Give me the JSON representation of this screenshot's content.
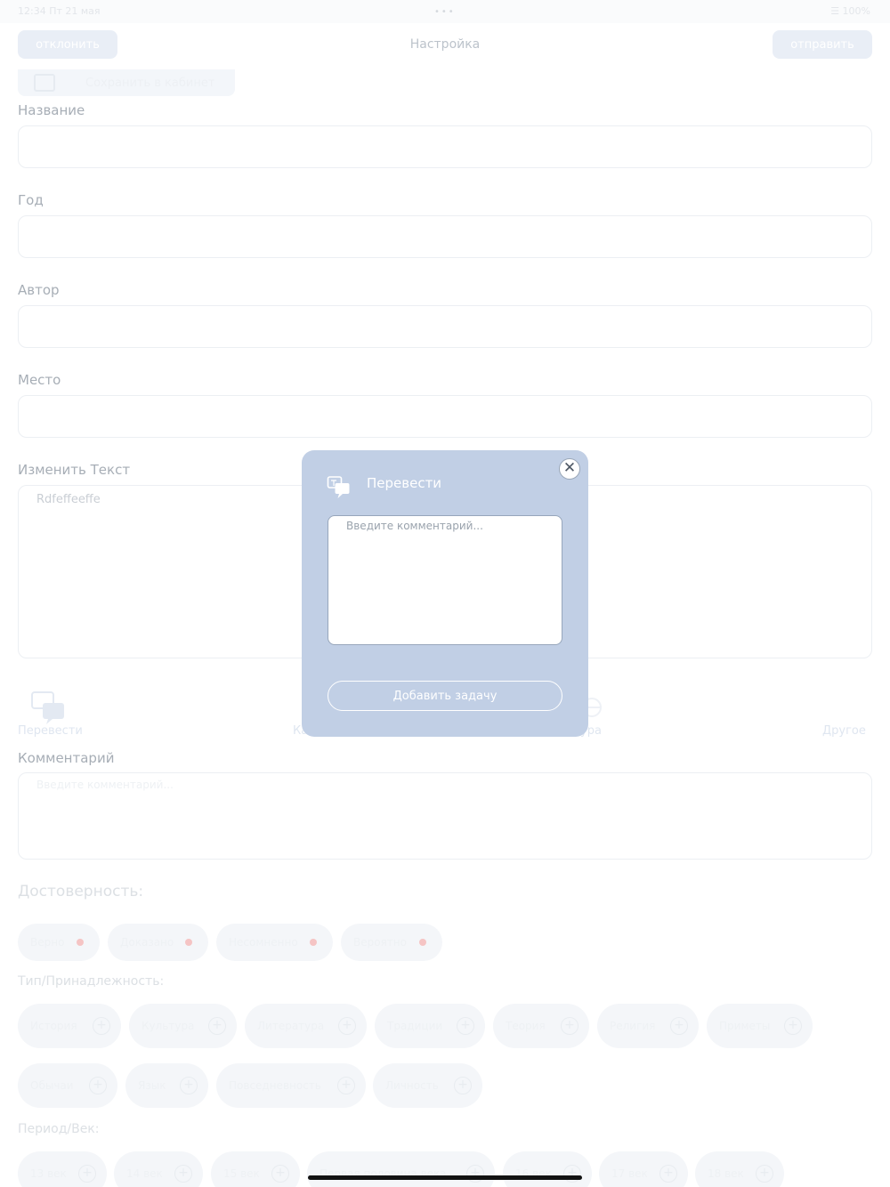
{
  "status_bar": {
    "left": "12:34  Пт 21 мая",
    "dots": "•••",
    "right": "☰  100%"
  },
  "header": {
    "decline_label": "отклонить",
    "title": "Настройка",
    "send_label": "отправить"
  },
  "save_button": {
    "label": "Сохранить в кабинет"
  },
  "fields": {
    "name_label": "Название",
    "name_value": "",
    "year_label": "Год",
    "year_value": "",
    "author_label": "Автор",
    "author_value": "",
    "place_label": "Место",
    "place_value": "",
    "text_label": "Изменить Текст",
    "text_value": "Rdfeffeeffe"
  },
  "categories": {
    "translate": "Перевести",
    "second": "Ка",
    "fourth": "ура",
    "other": "Другое"
  },
  "comment": {
    "label": "Комментарий",
    "placeholder": "Введите комментарий..."
  },
  "reliability": {
    "title": "Достоверность:",
    "chips": [
      "Верно",
      "Доказано",
      "Несомненно",
      "Вероятно"
    ]
  },
  "type": {
    "title": "Тип/Принадлежность:",
    "chips_row1": [
      "История",
      "Культура",
      "Литература",
      "Традиции",
      "Теория",
      "Религия",
      "Приметы"
    ],
    "chips_row2": [
      "Обычаи",
      "Язык",
      "Повседневность",
      "Личность"
    ]
  },
  "period": {
    "title": "Период/Век:",
    "chips": [
      "13 век",
      "14 век",
      "15 век",
      "Первая половина века",
      "16 век",
      "17 век",
      "18 век"
    ]
  },
  "modal": {
    "title": "Перевести",
    "placeholder": "Введите комментарий...",
    "submit_label": "Добавить задачу",
    "close_glyph": "✕"
  },
  "colors": {
    "modal_bg": "#c1cfe5",
    "accent": "#e9eef6",
    "reliability_dot": "#f5c4c4"
  }
}
